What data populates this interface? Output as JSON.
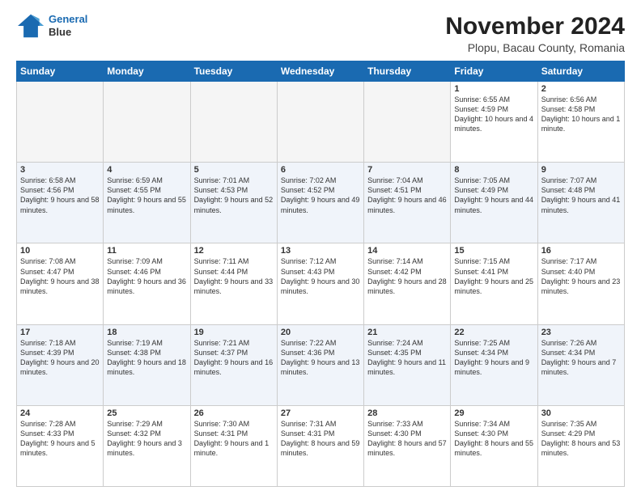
{
  "header": {
    "logo_line1": "General",
    "logo_line2": "Blue",
    "month_title": "November 2024",
    "subtitle": "Plopu, Bacau County, Romania"
  },
  "weekdays": [
    "Sunday",
    "Monday",
    "Tuesday",
    "Wednesday",
    "Thursday",
    "Friday",
    "Saturday"
  ],
  "weeks": [
    [
      {
        "day": "",
        "info": ""
      },
      {
        "day": "",
        "info": ""
      },
      {
        "day": "",
        "info": ""
      },
      {
        "day": "",
        "info": ""
      },
      {
        "day": "",
        "info": ""
      },
      {
        "day": "1",
        "info": "Sunrise: 6:55 AM\nSunset: 4:59 PM\nDaylight: 10 hours and 4 minutes."
      },
      {
        "day": "2",
        "info": "Sunrise: 6:56 AM\nSunset: 4:58 PM\nDaylight: 10 hours and 1 minute."
      }
    ],
    [
      {
        "day": "3",
        "info": "Sunrise: 6:58 AM\nSunset: 4:56 PM\nDaylight: 9 hours and 58 minutes."
      },
      {
        "day": "4",
        "info": "Sunrise: 6:59 AM\nSunset: 4:55 PM\nDaylight: 9 hours and 55 minutes."
      },
      {
        "day": "5",
        "info": "Sunrise: 7:01 AM\nSunset: 4:53 PM\nDaylight: 9 hours and 52 minutes."
      },
      {
        "day": "6",
        "info": "Sunrise: 7:02 AM\nSunset: 4:52 PM\nDaylight: 9 hours and 49 minutes."
      },
      {
        "day": "7",
        "info": "Sunrise: 7:04 AM\nSunset: 4:51 PM\nDaylight: 9 hours and 46 minutes."
      },
      {
        "day": "8",
        "info": "Sunrise: 7:05 AM\nSunset: 4:49 PM\nDaylight: 9 hours and 44 minutes."
      },
      {
        "day": "9",
        "info": "Sunrise: 7:07 AM\nSunset: 4:48 PM\nDaylight: 9 hours and 41 minutes."
      }
    ],
    [
      {
        "day": "10",
        "info": "Sunrise: 7:08 AM\nSunset: 4:47 PM\nDaylight: 9 hours and 38 minutes."
      },
      {
        "day": "11",
        "info": "Sunrise: 7:09 AM\nSunset: 4:46 PM\nDaylight: 9 hours and 36 minutes."
      },
      {
        "day": "12",
        "info": "Sunrise: 7:11 AM\nSunset: 4:44 PM\nDaylight: 9 hours and 33 minutes."
      },
      {
        "day": "13",
        "info": "Sunrise: 7:12 AM\nSunset: 4:43 PM\nDaylight: 9 hours and 30 minutes."
      },
      {
        "day": "14",
        "info": "Sunrise: 7:14 AM\nSunset: 4:42 PM\nDaylight: 9 hours and 28 minutes."
      },
      {
        "day": "15",
        "info": "Sunrise: 7:15 AM\nSunset: 4:41 PM\nDaylight: 9 hours and 25 minutes."
      },
      {
        "day": "16",
        "info": "Sunrise: 7:17 AM\nSunset: 4:40 PM\nDaylight: 9 hours and 23 minutes."
      }
    ],
    [
      {
        "day": "17",
        "info": "Sunrise: 7:18 AM\nSunset: 4:39 PM\nDaylight: 9 hours and 20 minutes."
      },
      {
        "day": "18",
        "info": "Sunrise: 7:19 AM\nSunset: 4:38 PM\nDaylight: 9 hours and 18 minutes."
      },
      {
        "day": "19",
        "info": "Sunrise: 7:21 AM\nSunset: 4:37 PM\nDaylight: 9 hours and 16 minutes."
      },
      {
        "day": "20",
        "info": "Sunrise: 7:22 AM\nSunset: 4:36 PM\nDaylight: 9 hours and 13 minutes."
      },
      {
        "day": "21",
        "info": "Sunrise: 7:24 AM\nSunset: 4:35 PM\nDaylight: 9 hours and 11 minutes."
      },
      {
        "day": "22",
        "info": "Sunrise: 7:25 AM\nSunset: 4:34 PM\nDaylight: 9 hours and 9 minutes."
      },
      {
        "day": "23",
        "info": "Sunrise: 7:26 AM\nSunset: 4:34 PM\nDaylight: 9 hours and 7 minutes."
      }
    ],
    [
      {
        "day": "24",
        "info": "Sunrise: 7:28 AM\nSunset: 4:33 PM\nDaylight: 9 hours and 5 minutes."
      },
      {
        "day": "25",
        "info": "Sunrise: 7:29 AM\nSunset: 4:32 PM\nDaylight: 9 hours and 3 minutes."
      },
      {
        "day": "26",
        "info": "Sunrise: 7:30 AM\nSunset: 4:31 PM\nDaylight: 9 hours and 1 minute."
      },
      {
        "day": "27",
        "info": "Sunrise: 7:31 AM\nSunset: 4:31 PM\nDaylight: 8 hours and 59 minutes."
      },
      {
        "day": "28",
        "info": "Sunrise: 7:33 AM\nSunset: 4:30 PM\nDaylight: 8 hours and 57 minutes."
      },
      {
        "day": "29",
        "info": "Sunrise: 7:34 AM\nSunset: 4:30 PM\nDaylight: 8 hours and 55 minutes."
      },
      {
        "day": "30",
        "info": "Sunrise: 7:35 AM\nSunset: 4:29 PM\nDaylight: 8 hours and 53 minutes."
      }
    ]
  ]
}
